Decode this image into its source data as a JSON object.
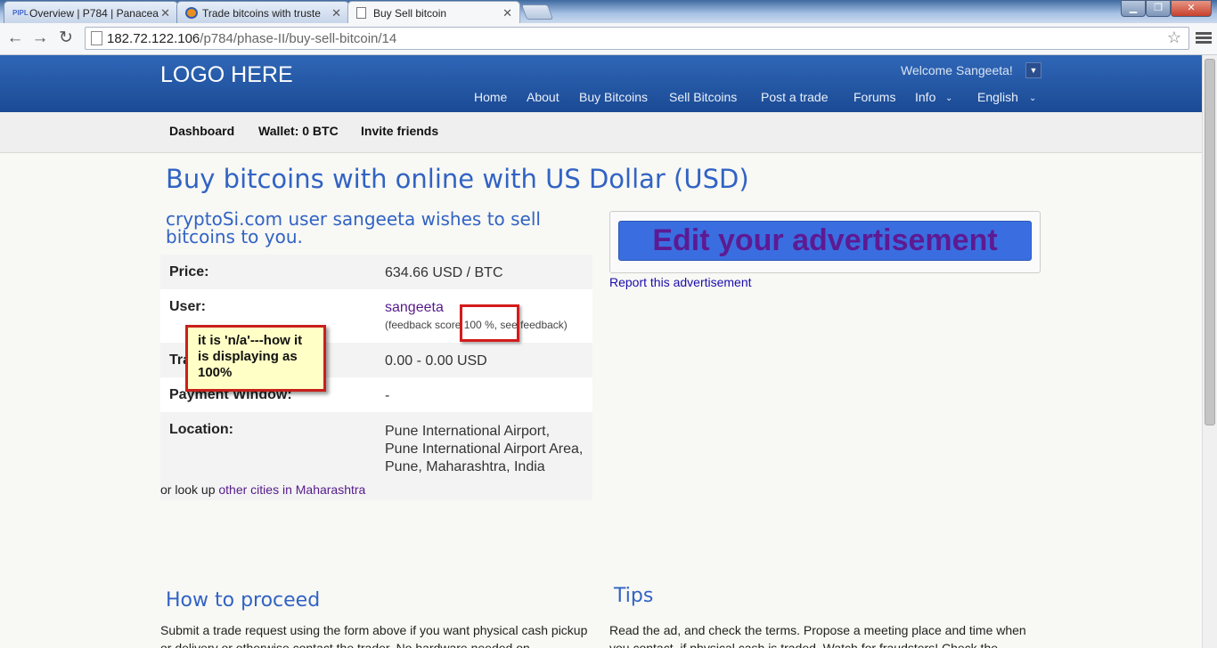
{
  "browser": {
    "tabs": [
      {
        "label": "Overview | P784 | Panacea",
        "icon": "pipl-favicon"
      },
      {
        "label": "Trade bitcoins with truste",
        "icon": "bitcoin-favicon"
      },
      {
        "label": "Buy Sell bitcoin",
        "icon": "page-icon"
      }
    ],
    "url_host": "182.72.122.106",
    "url_path": "/p784/phase-II/buy-sell-bitcoin/14"
  },
  "header": {
    "logo": "LOGO HERE",
    "welcome": "Welcome Sangeeta!",
    "nav": [
      "Home",
      "About",
      "Buy Bitcoins",
      "Sell Bitcoins",
      "Post a trade",
      "Forums",
      "Info",
      "English"
    ]
  },
  "subnav": {
    "dashboard": "Dashboard",
    "wallet": "Wallet: 0 BTC",
    "invite": "Invite friends"
  },
  "main": {
    "title": "Buy bitcoins with online with US Dollar (USD)",
    "subtitle": "cryptoSi.com user sangeeta wishes to sell bitcoins to you.",
    "price_label": "Price:",
    "price_value": "634.66 USD / BTC",
    "user_label": "User:",
    "user_name": "sangeeta",
    "feedback_text": "(feedback score 100 %, see feedback)",
    "trade_label": "Trade limits:",
    "trade_value": "0.00 - 0.00 USD",
    "payment_label": "Payment Window:",
    "payment_value": "-",
    "location_label": "Location:",
    "location_value": "Pune International Airport, Pune International Airport Area, Pune, Maharashtra, India",
    "lookup_prefix": "or look up",
    "lookup_link": "other cities in Maharashtra",
    "edit_button": "Edit your advertisement",
    "report_link": "Report this advertisement"
  },
  "annotation": {
    "text": "it is 'n/a'---how it is displaying as 100%"
  },
  "sections": {
    "how_title": "How to proceed",
    "how_text": "Submit a trade request using the form above if you want physical cash pickup or delivery or otherwise contact the trader. No hardware needed on",
    "tips_title": "Tips",
    "tips_text": "Read the ad, and check the terms. Propose a meeting place and time when you contact, if physical cash is traded. Watch for fraudsters! Check the"
  }
}
